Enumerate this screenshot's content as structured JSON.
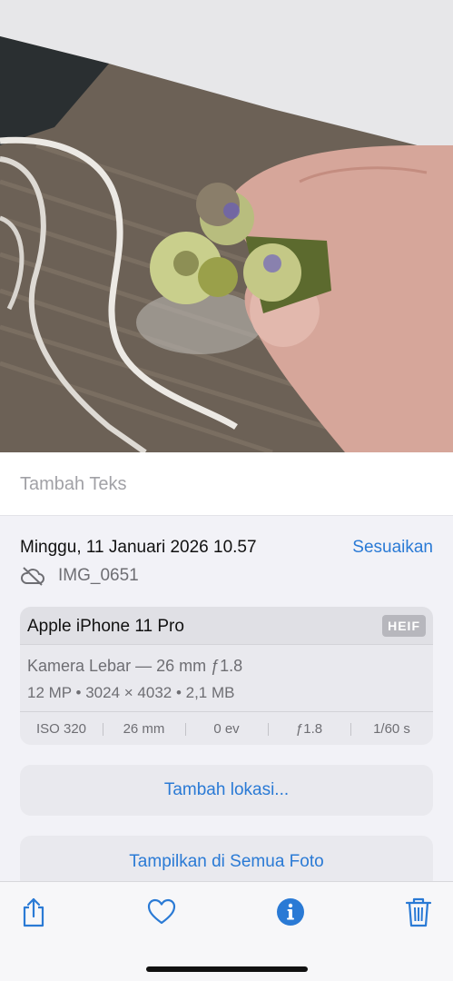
{
  "photo": {
    "description_icon": "photo-viewer"
  },
  "caption": {
    "placeholder": "Tambah Teks"
  },
  "info": {
    "datetime": "Minggu, 11 Januari 2026 10.57",
    "adjust_label": "Sesuaikan",
    "filename": "IMG_0651",
    "file_icon": "cloud-off-icon"
  },
  "camera": {
    "device": "Apple iPhone 11 Pro",
    "format_badge": "HEIF",
    "lens": "Kamera Lebar — 26 mm ƒ1.8",
    "specs": "12 MP  •  3024 × 4032  •  2,1 MB",
    "exif": [
      "ISO 320",
      "26 mm",
      "0 ev",
      "ƒ1.8",
      "1/60 s"
    ]
  },
  "actions": {
    "add_location": "Tambah lokasi...",
    "show_all": "Tampilkan di Semua Foto"
  },
  "toolbar": {
    "share_icon": "share-icon",
    "favorite_icon": "heart-icon",
    "info_icon": "info-icon",
    "delete_icon": "trash-icon"
  },
  "colors": {
    "accent": "#2a7ad5",
    "background": "#f2f2f7",
    "card": "#e9e9ee"
  }
}
